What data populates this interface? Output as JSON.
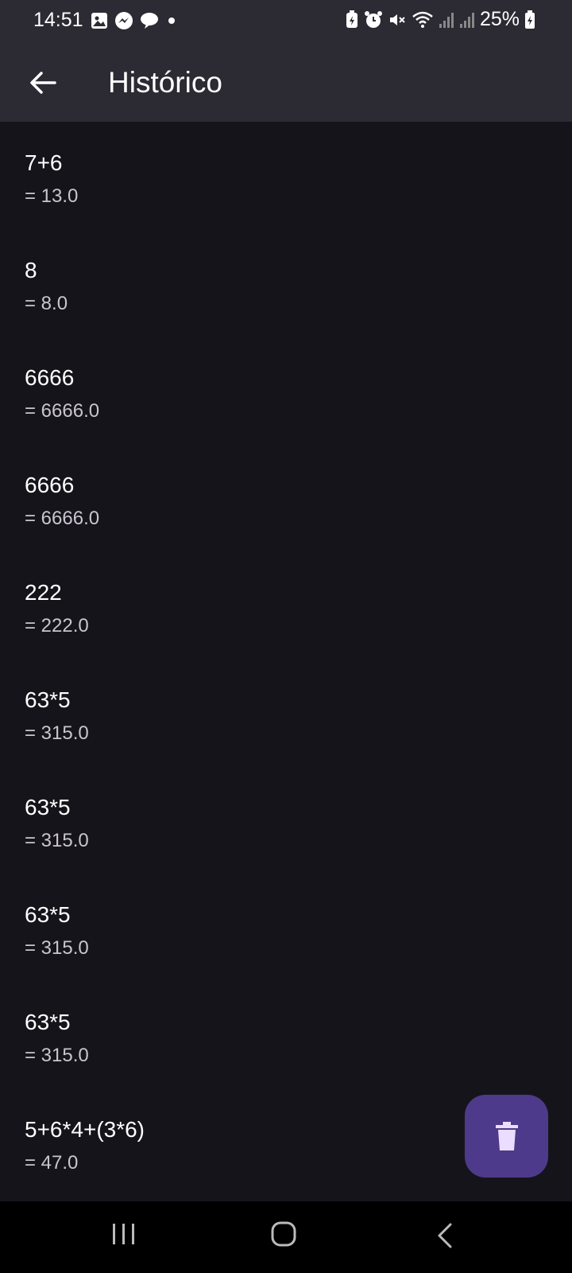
{
  "status_bar": {
    "time": "14:51",
    "battery": "25%",
    "left_icons": [
      "gallery-icon",
      "messenger-icon",
      "chat-icon",
      "dot-icon"
    ],
    "right_icons": [
      "battery-saver-icon",
      "alarm-icon",
      "mute-icon",
      "wifi-icon",
      "signal-icon",
      "signal-icon",
      "battery-icon"
    ]
  },
  "app_bar": {
    "title": "Histórico",
    "back_icon": "arrow-back-icon"
  },
  "history": [
    {
      "expression": "7+6",
      "result": "= 13.0"
    },
    {
      "expression": "8",
      "result": "= 8.0"
    },
    {
      "expression": "6666",
      "result": "= 6666.0"
    },
    {
      "expression": "6666",
      "result": "= 6666.0"
    },
    {
      "expression": "222",
      "result": "= 222.0"
    },
    {
      "expression": "63*5",
      "result": "= 315.0"
    },
    {
      "expression": "63*5",
      "result": "= 315.0"
    },
    {
      "expression": "63*5",
      "result": "= 315.0"
    },
    {
      "expression": "63*5",
      "result": "= 315.0"
    },
    {
      "expression": "5+6*4+(3*6)",
      "result": "= 47.0"
    }
  ],
  "fab": {
    "icon": "trash-icon",
    "color": "#4e3a8a"
  },
  "colors": {
    "background": "#16141b",
    "app_bar": "#2c2a33",
    "result_text": "#c9c5cf"
  },
  "nav_bar": {
    "icons": [
      "recent-apps-icon",
      "home-icon",
      "back-icon"
    ]
  }
}
